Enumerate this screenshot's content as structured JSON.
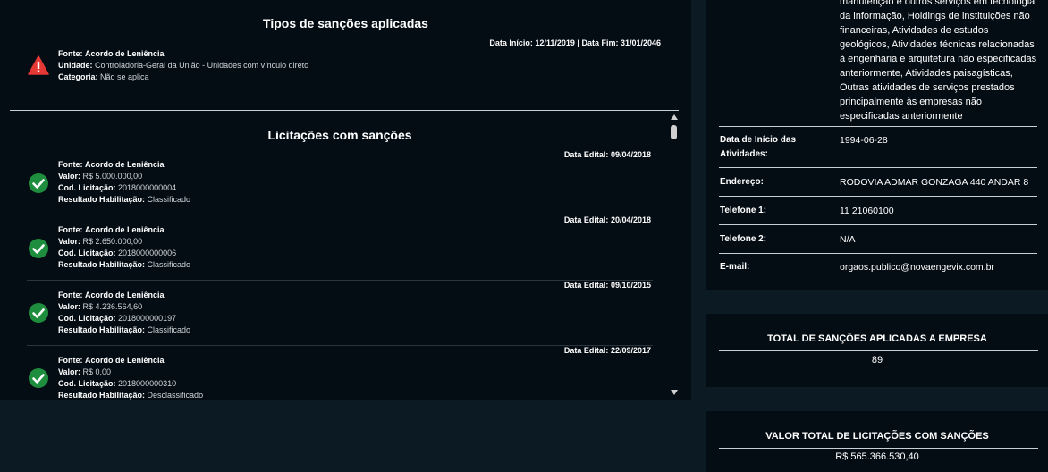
{
  "sanctions": {
    "title": "Tipos de sanções aplicadas",
    "dates": "Data Início: 12/11/2019 | Data Fim: 31/01/2046",
    "fonte_label": "Fonte:",
    "fonte_value": "Acordo de Leniência",
    "unidade_label": "Unidade:",
    "unidade_value": "Controladoria-Geral da União - Unidades com vínculo direto",
    "categoria_label": "Categoria:",
    "categoria_value": "Não se aplica",
    "icon": "warning-icon",
    "icon_color": "#e53935"
  },
  "licitacoes": {
    "title": "Licitações com sanções",
    "labels": {
      "data_edital": "Data Edital:",
      "fonte": "Fonte:",
      "valor": "Valor:",
      "cod": "Cod. Licitação:",
      "resultado": "Resultado Habilitação:"
    },
    "items": [
      {
        "data_edital": "09/04/2018",
        "fonte": "Acordo de Leniência",
        "valor": "R$ 5.000.000,00",
        "cod": "2018000000004",
        "resultado": "Classificado"
      },
      {
        "data_edital": "20/04/2018",
        "fonte": "Acordo de Leniência",
        "valor": "R$ 2.650.000,00",
        "cod": "2018000000006",
        "resultado": "Classificado"
      },
      {
        "data_edital": "09/10/2015",
        "fonte": "Acordo de Leniência",
        "valor": "R$ 4.236.564,60",
        "cod": "2018000000197",
        "resultado": "Classificado"
      },
      {
        "data_edital": "22/09/2017",
        "fonte": "Acordo de Leniência",
        "valor": "R$ 0,00",
        "cod": "2018000000310",
        "resultado": "Desclassificado"
      }
    ],
    "check_color": "#1e8e3e"
  },
  "company_info": {
    "activities_lines": [
      "manutenção e outros serviços em tecnologia",
      "da informação, Holdings de instituições não",
      "financeiras, Atividades de estudos",
      "geológicos, Atividades técnicas relacionadas",
      "à engenharia e arquitetura não especificadas",
      "anteriormente, Atividades paisagísticas,",
      "Outras atividades de serviços prestados",
      "principalmente às empresas não",
      "especificadas anteriormente"
    ],
    "rows": [
      {
        "key_line1": "Data de Início das",
        "key_line2": "Atividades:",
        "value": "1994-06-28"
      },
      {
        "key_line1": "Endereço:",
        "key_line2": "",
        "value": "RODOVIA ADMAR GONZAGA 440 ANDAR 8"
      },
      {
        "key_line1": "Telefone 1:",
        "key_line2": "",
        "value": "11 21060100"
      },
      {
        "key_line1": "Telefone 2:",
        "key_line2": "",
        "value": "N/A"
      },
      {
        "key_line1": "E-mail:",
        "key_line2": "",
        "value": "orgaos.publico@novaengevix.com.br"
      }
    ]
  },
  "total_sancoes": {
    "title": "TOTAL DE SANÇÕES APLICADAS A EMPRESA",
    "value": "89"
  },
  "valor_total": {
    "title": "VALOR TOTAL DE LICITAÇÕES COM SANÇÕES",
    "value": "R$ 565.366.530,40"
  }
}
